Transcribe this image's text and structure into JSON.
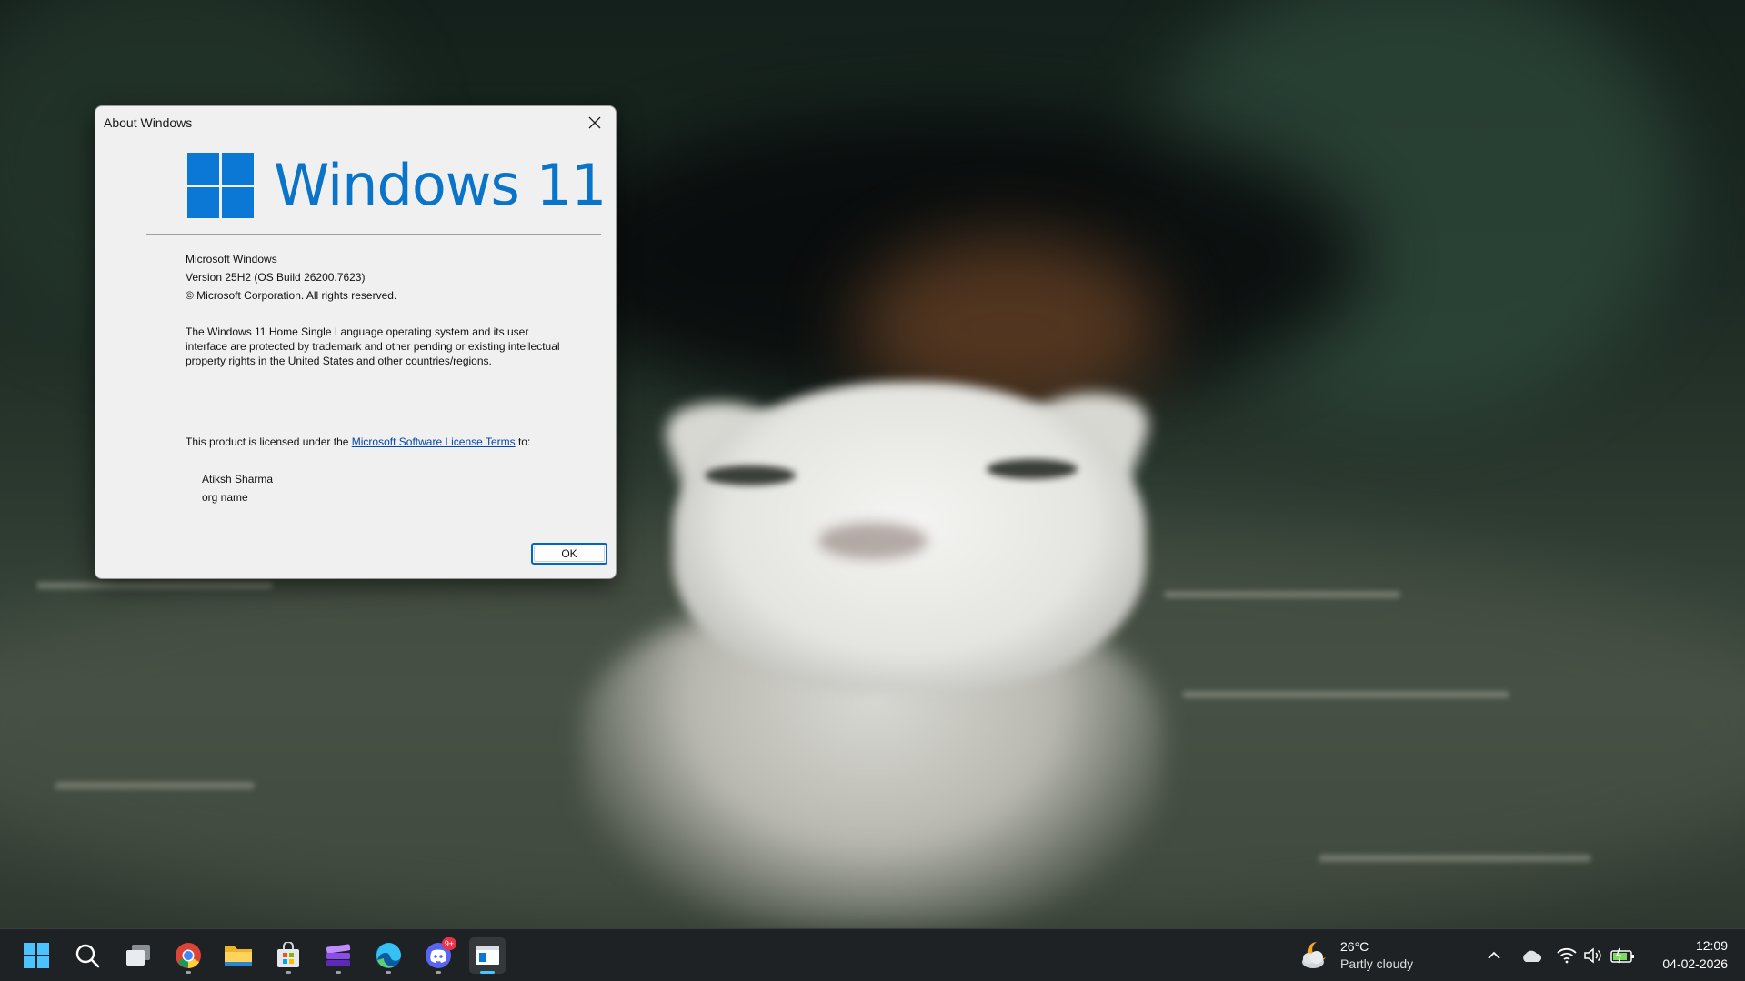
{
  "dialog": {
    "title": "About Windows",
    "logo_text": "Windows 11",
    "product_name": "Microsoft Windows",
    "version": "Version 25H2 (OS Build 26200.7623)",
    "copyright": "© Microsoft Corporation. All rights reserved.",
    "legal_text": "The Windows 11 Home Single Language operating system and its user interface are protected by trademark and other pending or existing intellectual property rights in the United States and other countries/regions.",
    "license_prefix": "This product is licensed under the ",
    "license_link": "Microsoft Software License Terms",
    "license_suffix": " to:",
    "licensed_user": "Atiksh Sharma",
    "licensed_org": "org name",
    "ok_label": "OK",
    "accent_color": "#0a78d4"
  },
  "taskbar": {
    "pinned_icons": [
      "windows-start-icon",
      "search-icon",
      "task-view-icon",
      "chrome-icon",
      "file-explorer-icon",
      "microsoft-store-icon",
      "clipchamp-icon",
      "edge-icon",
      "discord-icon",
      "about-windows-icon"
    ],
    "discord_badge": "9+",
    "weather": {
      "temperature": "26°C",
      "condition": "Partly cloudy",
      "icon": "partly-cloudy-night-icon"
    },
    "tray_icons": [
      "chevron-up-icon",
      "onedrive-icon",
      "wifi-icon",
      "volume-icon",
      "battery-icon"
    ],
    "time": "12:09",
    "date": "04-02-2026"
  }
}
